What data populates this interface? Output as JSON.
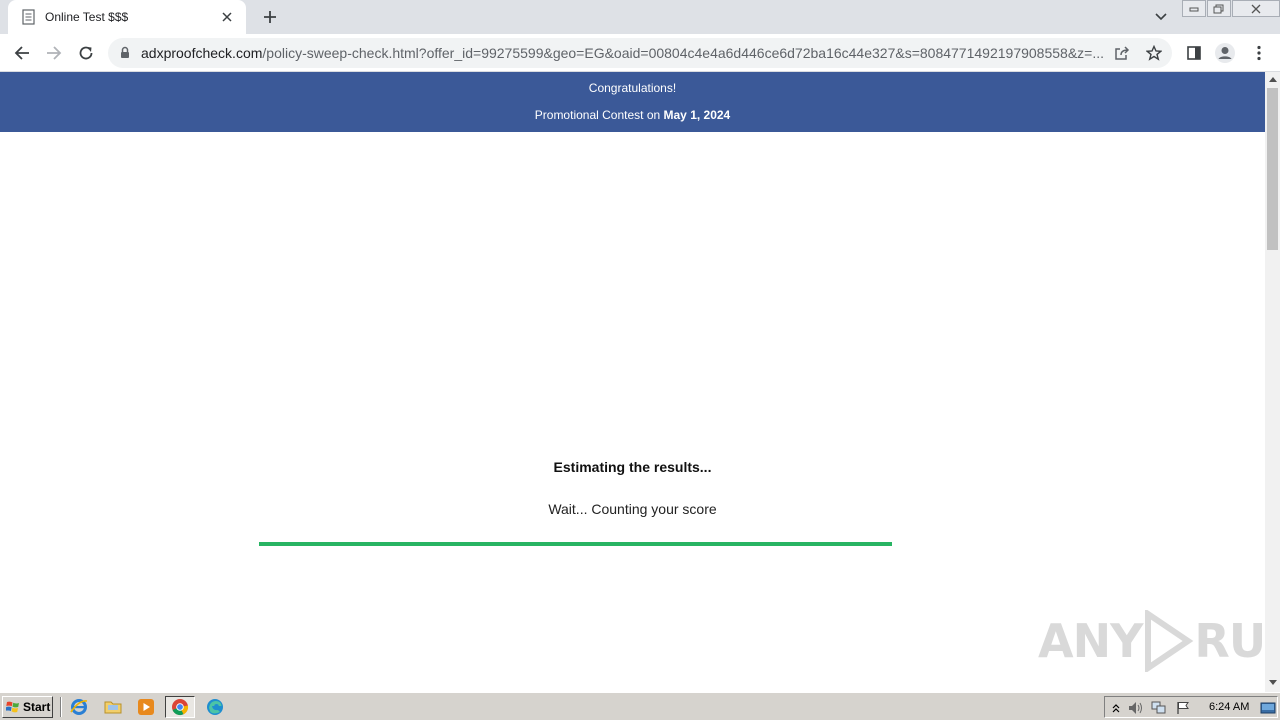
{
  "browser": {
    "tab_title": "Online Test $$$",
    "url_host": "adxproofcheck.com",
    "url_path": "/policy-sweep-check.html?offer_id=99275599&geo=EG&oaid=00804c4e4a6d446ce6d72ba16c44e327&s=8084771492197908558&z=..."
  },
  "page": {
    "banner_line1": "Congratulations!",
    "banner_line2_prefix": "Promotional Contest on",
    "banner_date": "May 1, 2024",
    "estimating_title": "Estimating the results...",
    "estimating_subtitle": "Wait... Counting your score",
    "progress_fraction": 1.0,
    "progress_color": "#28b463",
    "banner_color": "#3b5998"
  },
  "watermark": {
    "text_left": "ANY",
    "text_right": "RUN"
  },
  "taskbar": {
    "start_label": "Start",
    "clock": "6:24 AM",
    "quick_launch": [
      "ie-icon",
      "folder-icon",
      "media-player-icon",
      "chrome-icon",
      "edge-icon"
    ]
  }
}
